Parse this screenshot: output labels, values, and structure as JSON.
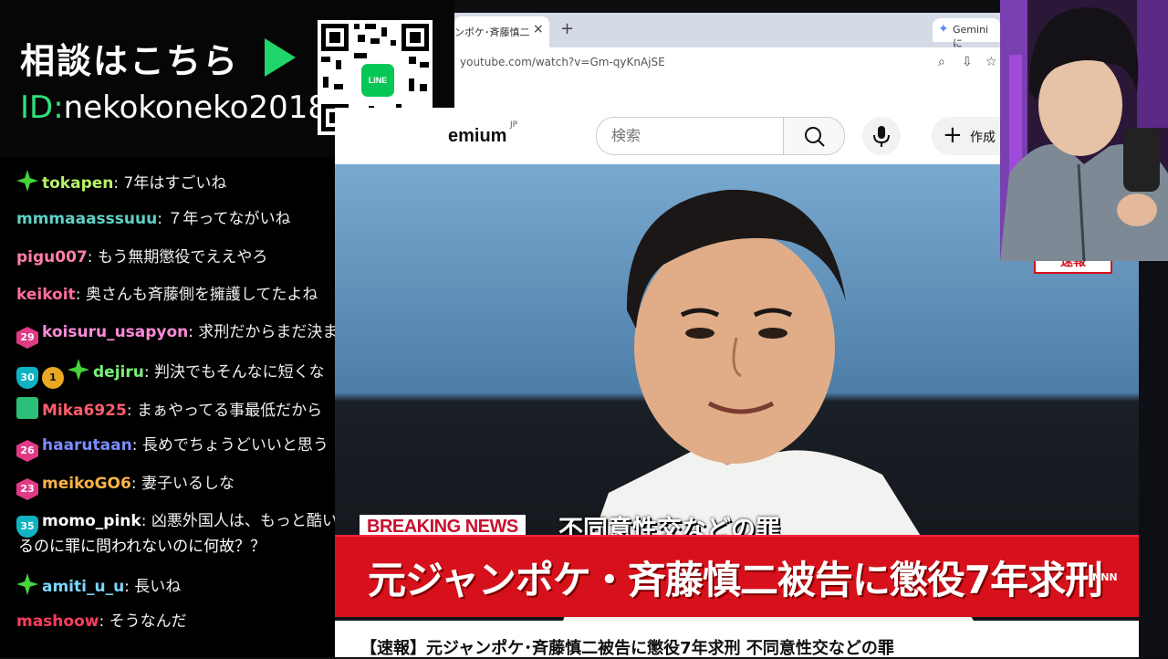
{
  "banner": {
    "title": "相談はこちら",
    "id_prefix": "ID:",
    "id_value": "nekokoneko2018",
    "qr_badge": "LINE",
    "accent": "#1fd66a"
  },
  "chat": {
    "messages": [
      {
        "badges": [
          "star"
        ],
        "user": "tokapen",
        "color": "#b6f36a",
        "text": ": 7年はすごいね"
      },
      {
        "badges": [],
        "user": "mmmaaasssuuu",
        "color": "#5fd1c6",
        "text": ": ７年ってながいね"
      },
      {
        "badges": [],
        "user": "pigu007",
        "color": "#ff7fa7",
        "text": ": もう無期懲役でええやろ"
      },
      {
        "badges": [],
        "user": "keikoit",
        "color": "#ff6e9c",
        "text": ": 奥さんも斉藤側を擁護してたよね"
      },
      {
        "badges": [
          "hex:29"
        ],
        "user": "koisuru_usapyon",
        "color": "#ff8ad8",
        "text": ": 求刑だからまだ決ま"
      },
      {
        "badges": [
          "shield:30",
          "coin:1",
          "star"
        ],
        "user": "dejiru",
        "color": "#7cf07a",
        "text": ": 判決でもそんなに短くな"
      },
      {
        "badges": [
          "gift"
        ],
        "user": "Mika6925",
        "color": "#ff5d6e",
        "text": ": まぁやってる事最低だから"
      },
      {
        "badges": [
          "hex:26"
        ],
        "user": "haarutaan",
        "color": "#7b8cff",
        "text": ": 長めでちょうどいいと思う"
      },
      {
        "badges": [
          "hex:23"
        ],
        "user": "meikoGO6",
        "color": "#ffb347",
        "text": ": 妻子いるしな"
      },
      {
        "badges": [
          "shield:35"
        ],
        "user": "momo_pink",
        "color": "#ffffff",
        "text": ": 凶悪外国人は、もっと酷い",
        "text2": "るのに罪に問われないのに何故？？"
      },
      {
        "badges": [
          "star"
        ],
        "user": "amiti_u_u",
        "color": "#7ad6ff",
        "text": ": 長いね"
      },
      {
        "badges": [],
        "user": "mashoow",
        "color": "#ff3b5c",
        "text": ": そうなんだ"
      }
    ]
  },
  "browser": {
    "tab_title": "ンポケ･斉藤慎二",
    "tab_close": "×",
    "new_tab": "+",
    "gemini_label": "Gemini に",
    "url": "youtube.com/watch?v=Gm-qyKnAjSE"
  },
  "youtube": {
    "logo": "emium",
    "logo_sup": "JP",
    "search_placeholder": "検索",
    "create_label": "作成"
  },
  "video": {
    "breaking_label": "BREAKING NEWS",
    "charge": "不同意性交などの罪",
    "headline": "元ジャンポケ・斉藤慎二被告に懲役7年求刑",
    "corner_tag": "速報",
    "broadcaster": "NNN"
  },
  "video_title": "【速報】元ジャンポケ･斉藤慎二被告に懲役7年求刑 不同意性交などの罪"
}
